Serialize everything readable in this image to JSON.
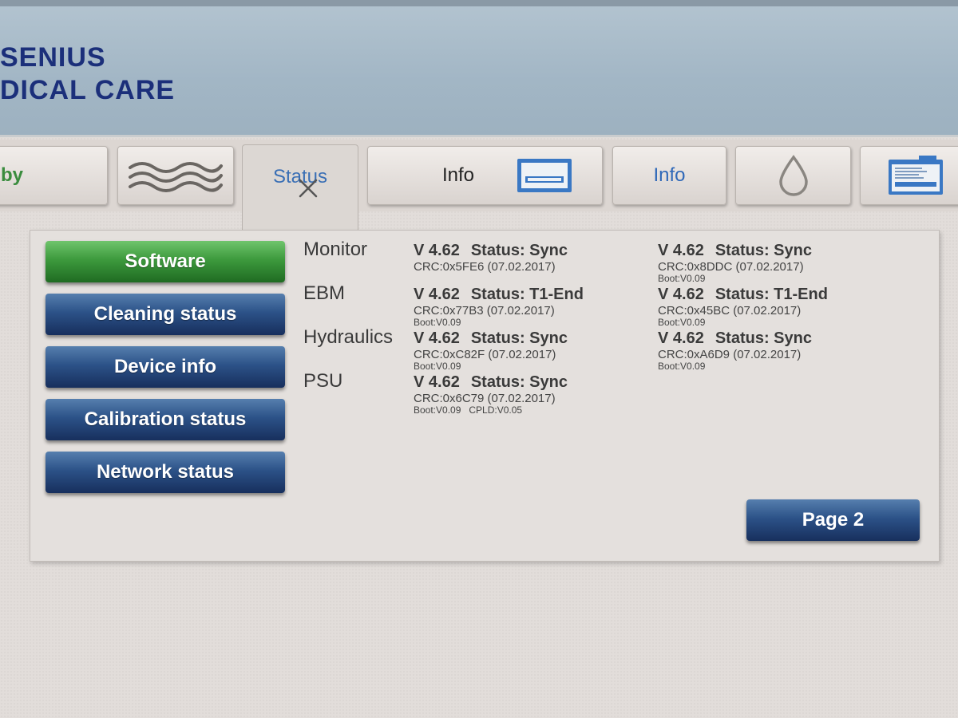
{
  "header": {
    "logo_line1": "SENIUS",
    "logo_line2": "DICAL CARE"
  },
  "tabs": [
    {
      "label": "by",
      "icon": null
    },
    {
      "label": "",
      "icon": "waves-icon"
    },
    {
      "label": "Status",
      "icon": "close-icon",
      "active": true
    },
    {
      "label": "Info",
      "icon": "card-reader-icon"
    },
    {
      "label": "Info",
      "icon": null
    },
    {
      "label": "",
      "icon": "droplet-icon"
    },
    {
      "label": "",
      "icon": "document-icon"
    }
  ],
  "menu": {
    "software": "Software",
    "cleaning_status": "Cleaning status",
    "device_info": "Device info",
    "calibration_status": "Calibration status",
    "network_status": "Network status",
    "page2": "Page 2"
  },
  "modules": [
    {
      "name": "Monitor",
      "left": {
        "version": "V 4.62",
        "status": "Status: Sync",
        "crc": "CRC:0x5FE6 (07.02.2017)",
        "boot": "",
        "cpld": ""
      },
      "right": {
        "version": "V 4.62",
        "status": "Status: Sync",
        "crc": "CRC:0x8DDC (07.02.2017)",
        "boot": "Boot:V0.09"
      }
    },
    {
      "name": "EBM",
      "left": {
        "version": "V 4.62",
        "status": "Status: T1-End",
        "crc": "CRC:0x77B3 (07.02.2017)",
        "boot": "Boot:V0.09",
        "cpld": ""
      },
      "right": {
        "version": "V 4.62",
        "status": "Status: T1-End",
        "crc": "CRC:0x45BC (07.02.2017)",
        "boot": "Boot:V0.09"
      }
    },
    {
      "name": "Hydraulics",
      "left": {
        "version": "V 4.62",
        "status": "Status: Sync",
        "crc": "CRC:0xC82F (07.02.2017)",
        "boot": "Boot:V0.09",
        "cpld": ""
      },
      "right": {
        "version": "V 4.62",
        "status": "Status: Sync",
        "crc": "CRC:0xA6D9 (07.02.2017)",
        "boot": "Boot:V0.09"
      }
    },
    {
      "name": "PSU",
      "left": {
        "version": "V 4.62",
        "status": "Status: Sync",
        "crc": "CRC:0x6C79 (07.02.2017)",
        "boot": "Boot:V0.09",
        "cpld": "CPLD:V0.05"
      }
    }
  ],
  "colors": {
    "brand": "#1b2f7a",
    "button_blue": "#2c5288",
    "button_green": "#3d9a3d",
    "tab_text_blue": "#2f68b8"
  }
}
